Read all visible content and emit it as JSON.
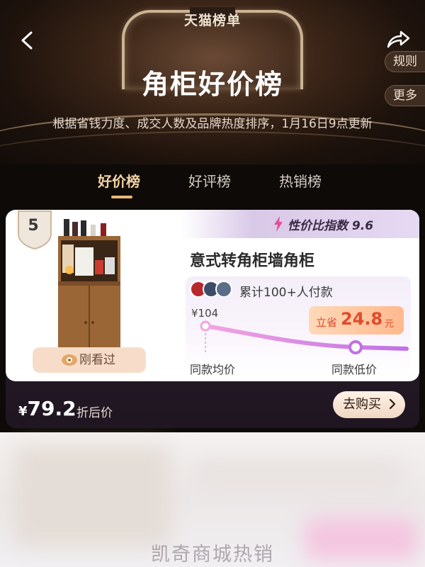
{
  "header": {
    "brand": "天猫榜单",
    "title": "角柜好价榜",
    "subtitle": "根据省钱力度、成交人数及品牌热度排序，1月16日9点更新",
    "rule_label": "规则",
    "more_label": "更多"
  },
  "tabs": [
    {
      "label": "好价榜",
      "active": true
    },
    {
      "label": "好评榜",
      "active": false
    },
    {
      "label": "热销榜",
      "active": false
    }
  ],
  "product": {
    "rank": "5",
    "value_index_label": "性价比指数 9.6",
    "name": "意式转角柜墙角柜",
    "seen_label": "刚看过",
    "paid_count": "累计100+人付款",
    "original_price": "¥104",
    "save_prefix": "立省",
    "save_amount": "24.8",
    "save_unit": "元",
    "avg_label": "同款均价",
    "low_label": "同款低价",
    "final_price": "79.2",
    "final_currency": "¥",
    "final_suffix": "折后价",
    "buy_label": "去购买"
  },
  "footer": {
    "watermark": "凯奇商城热销"
  },
  "colors": {
    "accent_tab": "#f4d3a2",
    "save_red": "#e04b2c",
    "badge_purple": "#3b2a46"
  }
}
